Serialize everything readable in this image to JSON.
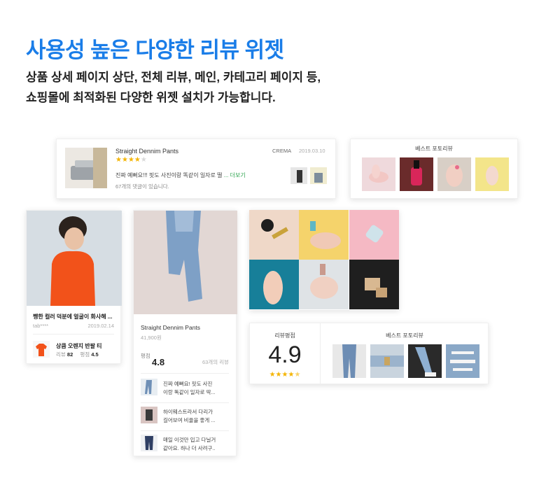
{
  "hero": {
    "title": "사용성 높은 다양한 리뷰 위젯",
    "subtitle_line1": "상품 상세 페이지 상단, 전체 리뷰, 메인, 카테고리 페이지 등,",
    "subtitle_line2": "쇼핑몰에 최적화된 다양한 위젯 설치가 가능합니다."
  },
  "review_card": {
    "product": "Straight Dennim Pants",
    "stars": 4,
    "brand": "CREMA",
    "date": "2019.03.10",
    "review_text": "진짜 예뻐요!!! 핏도 사진이랑 똑같이 일자로 떨",
    "more": "... 더보기",
    "comments": "67개의 댓글이 있습니다."
  },
  "best_photo_top": {
    "title": "베스트 포토리뷰"
  },
  "feed_card": {
    "title": "쨍한 컬러 덕분에 얼굴이 화사해 ...",
    "user": "tab****",
    "date": "2019.02.14",
    "product": "상큼 오렌지 반팔 티",
    "review_label": "리뷰",
    "review_count": "82",
    "rating_label": "평점",
    "rating": "4.5"
  },
  "product_card": {
    "name": "Straight Dennim Pants",
    "price": "41,900원",
    "rating_label": "평점",
    "rating": "4.8",
    "review_count": "63개의 리뷰",
    "reviews": [
      {
        "line1": "진짜 예뻐요! 핏도 사진",
        "line2": "이랑 똑같이 일자로 딱..."
      },
      {
        "line1": "하이웨스트라서 다리가",
        "line2": "길어보여 비율을 좋게 ..."
      },
      {
        "line1": "매일 이것만 입고 다닐거",
        "line2": "같아요. 하나 더 사려구.."
      }
    ]
  },
  "rating_card": {
    "title": "리뷰평점",
    "score": "4.9",
    "stars": 4.5,
    "best_title": "베스트 포토리뷰"
  },
  "icons": {
    "star": "★"
  }
}
